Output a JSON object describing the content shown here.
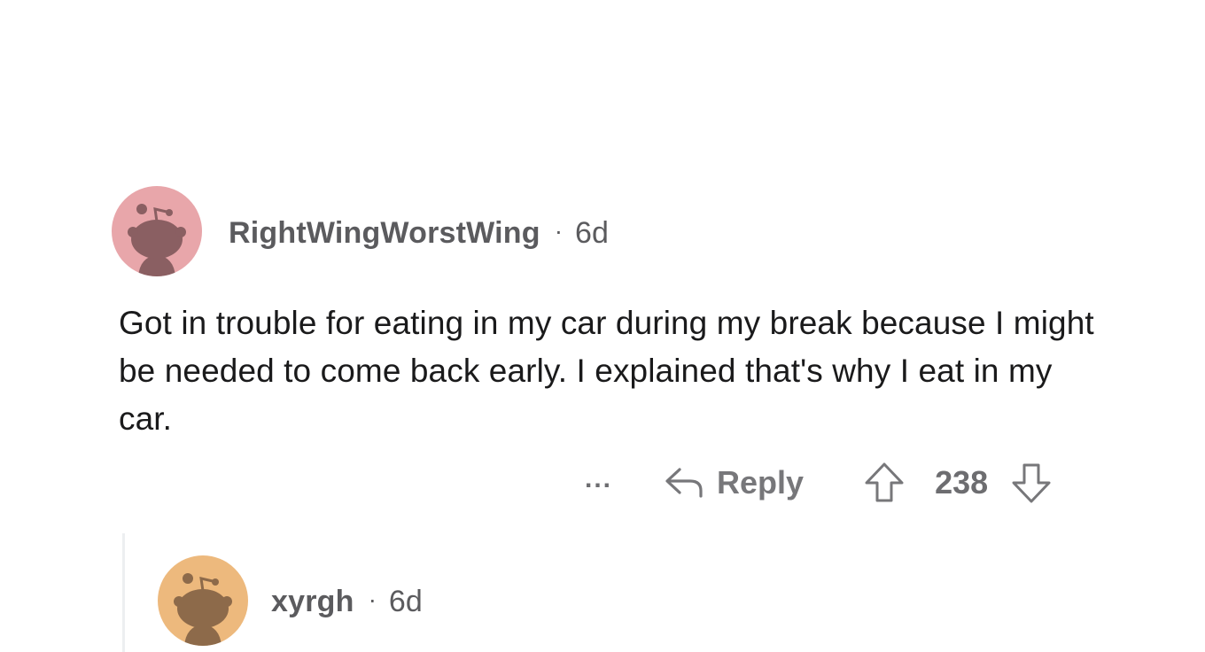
{
  "comment": {
    "author": "RightWingWorstWing",
    "separator": "·",
    "age": "6d",
    "avatar_color": "#e8a6aa",
    "avatar_icon": "snoo-avatar-icon",
    "body": "Got in trouble for eating in my car during my break because I might be needed to come back early. I explained that's why I eat in my car.",
    "actions": {
      "more_label": "...",
      "reply_label": "Reply",
      "score": "238"
    }
  },
  "reply_comment": {
    "author": "xyrgh",
    "separator": "·",
    "age": "6d",
    "avatar_color": "#edb97d",
    "avatar_icon": "snoo-avatar-icon"
  }
}
